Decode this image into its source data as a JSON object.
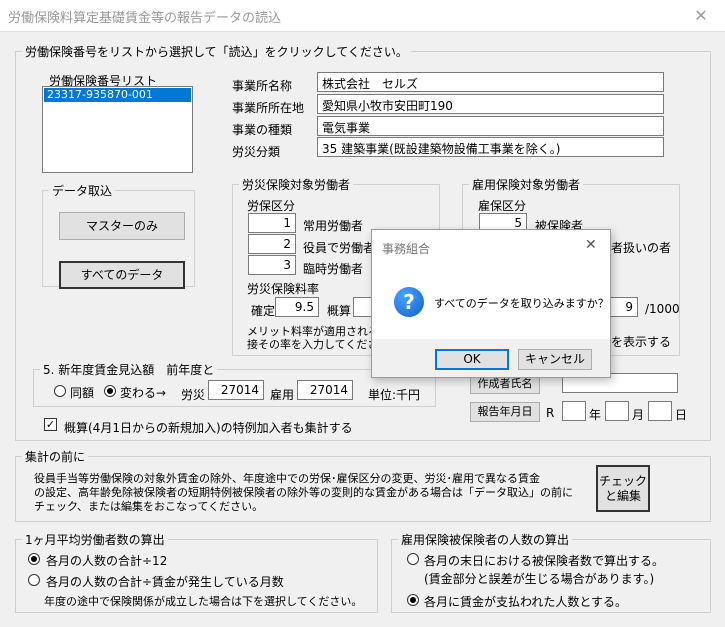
{
  "window": {
    "title": "労働保険料算定基礎賃金等の報告データの読込",
    "close": "✕"
  },
  "main_group": {
    "legend": "労働保険番号をリストから選択して「読込」をクリックしてください。"
  },
  "list": {
    "label": "労働保険番号リスト",
    "items": [
      "23317-935870-001"
    ]
  },
  "office": {
    "name_label": "事業所名称",
    "name_value": "株式会社　セルズ",
    "address_label": "事業所所在地",
    "address_value": "愛知県小牧市安田町190",
    "type_label": "事業の種類",
    "type_value": "電気事業",
    "category_label": "労災分類",
    "category_value": "35 建築事業(既設建築物設備工事業を除く。)"
  },
  "data_import": {
    "legend": "データ取込",
    "master_button": "マスターのみ",
    "all_button": "すべてのデータ"
  },
  "rosai": {
    "legend": "労災保険対象労働者",
    "kubun_label": "労保区分",
    "rows": [
      {
        "value": "1",
        "label": "常用労働者"
      },
      {
        "value": "2",
        "label": "役員で労働者"
      },
      {
        "value": "3",
        "label": "臨時労働者"
      }
    ],
    "rate_label": "労災保険料率",
    "kakutei_label": "確定",
    "kakutei_value": "9.5",
    "gaisan_label": "概算",
    "note_line1": "メリット料率が適用される場",
    "note_line2": "接その率を入力してください"
  },
  "koyo": {
    "legend": "雇用保険対象労働者",
    "kubun_label": "雇保区分",
    "row1_value": "5",
    "row1_label": "被保険者",
    "row2_tail": "者扱いの者",
    "rate_value": "9",
    "rate_unit": "/1000",
    "note_tail": "を表示する"
  },
  "new_year": {
    "legend": "5. 新年度賃金見込額　前年度と",
    "opt_same": "同額",
    "opt_change": "変わる→",
    "rosai_label": "労災",
    "rosai_value": "27014",
    "koyo_label": "雇用",
    "koyo_value": "27014",
    "unit": "単位:千円"
  },
  "author_button": "作成者氏名",
  "report_date": {
    "button": "報告年月日",
    "era": "R",
    "year": "年",
    "month": "月",
    "day": "日"
  },
  "checkbox_label": "概算(4月1日からの新規加入)の特例加入者も集計する",
  "before_total": {
    "legend": "集計の前に",
    "text_line1": "役員手当等労働保険の対象外賃金の除外、年度途中での労保･雇保区分の変更、労災･雇用で異なる賃金",
    "text_line2": "の設定、高年齢免除被保険者の短期特例被保険者の除外等の変則的な賃金がある場合は「データ取込」の前に",
    "text_line3": "チェック、または編集をおこなってください。",
    "check_button_line1": "チェック",
    "check_button_line2": "と編集"
  },
  "avg": {
    "legend": "1ヶ月平均労働者数の算出",
    "opt1": "各月の人数の合計÷12",
    "opt2": "各月の人数の合計÷賃金が発生している月数",
    "note": "年度の途中で保険関係が成立した場合は下を選択してください。"
  },
  "insured": {
    "legend": "雇用保険被保険者の人数の算出",
    "opt1": "各月の末日における被保険者数で算出する。",
    "opt1_note": "(賃金部分と誤差が生じる場合があります。)",
    "opt2": "各月に賃金が支払われた人数とする。"
  },
  "dialog": {
    "title": "事務組合",
    "close": "✕",
    "icon": "?",
    "message": "すべてのデータを取り込みますか？",
    "ok": "OK",
    "cancel": "キャンセル"
  }
}
